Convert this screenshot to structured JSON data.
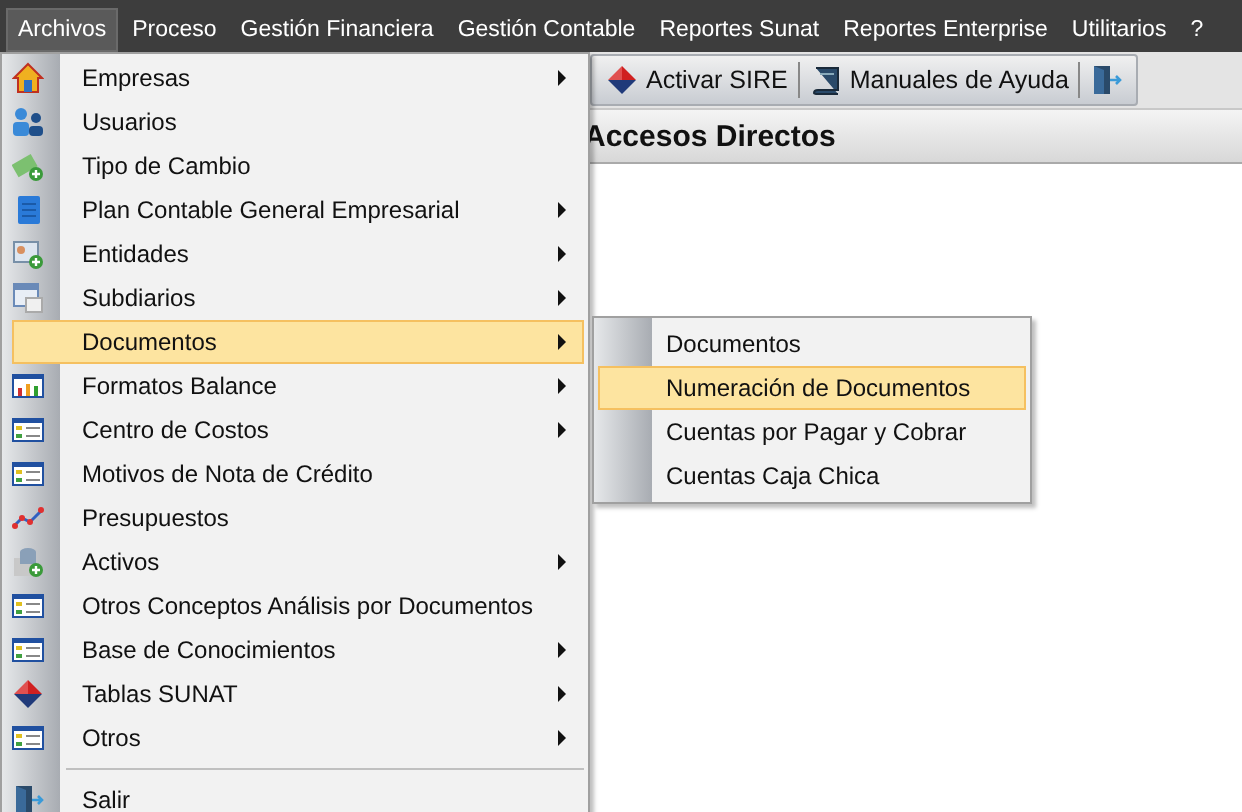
{
  "menu_bar": [
    {
      "label": "Archivos",
      "selected": true
    },
    {
      "label": "Proceso",
      "selected": false
    },
    {
      "label": "Gestión Financiera",
      "selected": false
    },
    {
      "label": "Gestión Contable",
      "selected": false
    },
    {
      "label": "Reportes Sunat",
      "selected": false
    },
    {
      "label": "Reportes Enterprise",
      "selected": false
    },
    {
      "label": "Utilitarios",
      "selected": false
    },
    {
      "label": "?",
      "selected": false
    }
  ],
  "toolbar": [
    {
      "kind": "button",
      "label": "Activar SIRE"
    },
    {
      "kind": "button",
      "label": "Manuales de Ayuda"
    },
    {
      "kind": "icon_button"
    }
  ],
  "panel": {
    "title": "Accesos Directos"
  },
  "menu": [
    {
      "label": "Empresas",
      "submenu": true,
      "selected": false
    },
    {
      "label": "Usuarios",
      "submenu": false,
      "selected": false
    },
    {
      "label": "Tipo de Cambio",
      "submenu": false,
      "selected": false
    },
    {
      "label": "Plan Contable General Empresarial",
      "submenu": true,
      "selected": false
    },
    {
      "label": "Entidades",
      "submenu": true,
      "selected": false
    },
    {
      "label": "Subdiarios",
      "submenu": true,
      "selected": false
    },
    {
      "label": "Documentos",
      "submenu": true,
      "selected": true
    },
    {
      "label": "Formatos Balance",
      "submenu": true,
      "selected": false
    },
    {
      "label": "Centro de Costos",
      "submenu": true,
      "selected": false
    },
    {
      "label": "Motivos de Nota de Crédito",
      "submenu": false,
      "selected": false
    },
    {
      "label": "Presupuestos",
      "submenu": false,
      "selected": false
    },
    {
      "label": "Activos",
      "submenu": true,
      "selected": false
    },
    {
      "label": "Otros Conceptos Análisis por Documentos",
      "submenu": false,
      "selected": false
    },
    {
      "label": "Base de Conocimientos",
      "submenu": true,
      "selected": false
    },
    {
      "label": "Tablas SUNAT",
      "submenu": true,
      "selected": false
    },
    {
      "label": "Otros",
      "submenu": true,
      "selected": false
    },
    {
      "kind": "separator"
    },
    {
      "label": "Salir",
      "submenu": false,
      "selected": false
    }
  ],
  "submenu": [
    {
      "label": "Documentos",
      "selected": false
    },
    {
      "label": "Numeración de Documentos",
      "selected": true
    },
    {
      "label": "Cuentas por Pagar y Cobrar",
      "selected": false
    },
    {
      "label": "Cuentas Caja Chica",
      "selected": false
    }
  ]
}
